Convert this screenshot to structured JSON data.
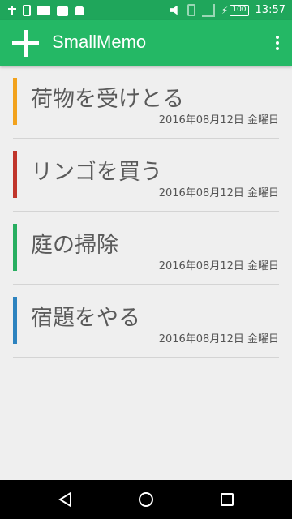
{
  "status_bar": {
    "time": "13:57",
    "battery": "100",
    "left_icons": [
      "usb-icon",
      "phone-icon",
      "photo-icon",
      "shopping-bag-icon",
      "android-icon"
    ],
    "right_icons": [
      "mute-icon",
      "sim-icon",
      "signal-icon",
      "charging-icon"
    ]
  },
  "toolbar": {
    "title": "SmallMemo",
    "add_icon": "plus-icon",
    "menu_icon": "more-vert-icon",
    "color": "#24b865"
  },
  "memos": [
    {
      "title": "荷物を受けとる",
      "date": "2016年08月12日 金曜日",
      "color": "#f2a21c"
    },
    {
      "title": "リンゴを買う",
      "date": "2016年08月12日 金曜日",
      "color": "#c0352b"
    },
    {
      "title": "庭の掃除",
      "date": "2016年08月12日 金曜日",
      "color": "#27ae60"
    },
    {
      "title": "宿題をやる",
      "date": "2016年08月12日 金曜日",
      "color": "#2d83bf"
    }
  ],
  "nav_bar": {
    "buttons": [
      "back-icon",
      "home-icon",
      "recents-icon"
    ]
  }
}
